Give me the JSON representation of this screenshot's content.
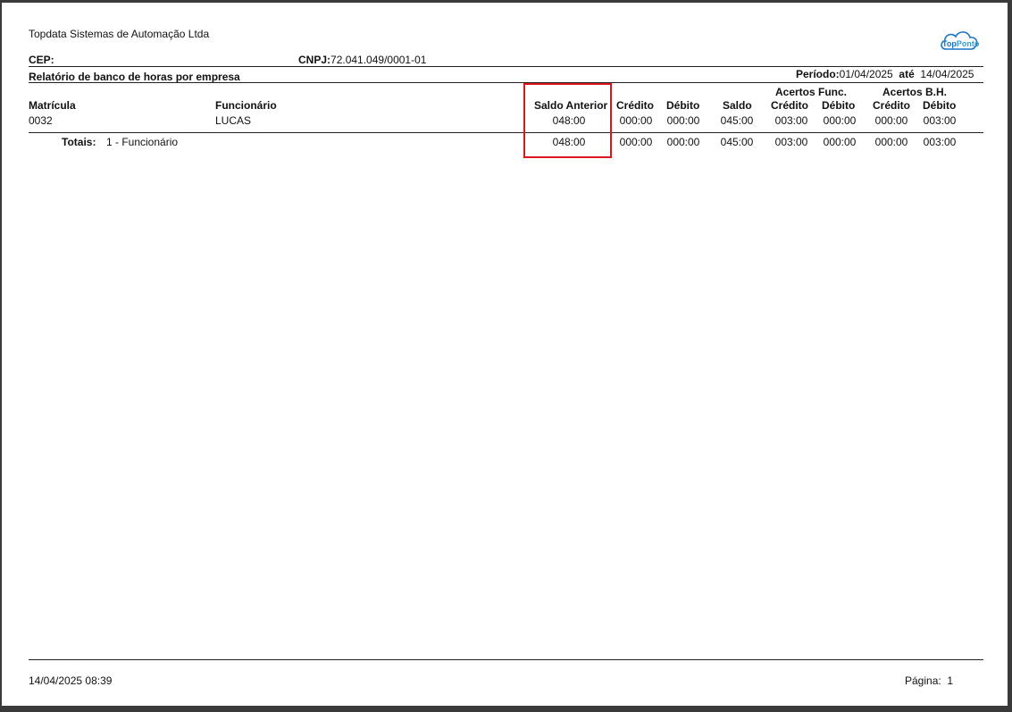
{
  "header": {
    "company": "Topdata Sistemas de Automação Ltda",
    "cep_label": "CEP:",
    "cnpj_label": "CNPJ:",
    "cnpj_value": "72.041.049/0001-01",
    "report_title": "Relatório de banco de horas por empresa",
    "period_label": "Período:",
    "period_start": "01/04/2025",
    "period_until": "até",
    "period_end": "14/04/2025",
    "logo_top": "Top",
    "logo_ponto": "Ponto"
  },
  "colors": {
    "highlight": "#d8161c",
    "logo_blue": "#1a74c4"
  },
  "columns": {
    "matricula": "Matrícula",
    "funcionario": "Funcionário",
    "saldo_anterior": "Saldo Anterior",
    "credito": "Crédito",
    "debito": "Débito",
    "saldo": "Saldo",
    "acertos_func": "Acertos Func.",
    "acertos_func_credito": "Crédito",
    "acertos_func_debito": "Débito",
    "acertos_bh": "Acertos B.H.",
    "acertos_bh_credito": "Crédito",
    "acertos_bh_debito": "Débito"
  },
  "rows": [
    {
      "matricula": "0032",
      "funcionario": "LUCAS",
      "saldo_anterior": "048:00",
      "credito": "000:00",
      "debito": "000:00",
      "saldo": "045:00",
      "af_credito": "003:00",
      "af_debito": "000:00",
      "bh_credito": "000:00",
      "bh_debito": "003:00"
    }
  ],
  "totals": {
    "label": "Totais:",
    "count": "1 - Funcionário",
    "saldo_anterior": "048:00",
    "credito": "000:00",
    "debito": "000:00",
    "saldo": "045:00",
    "af_credito": "003:00",
    "af_debito": "000:00",
    "bh_credito": "000:00",
    "bh_debito": "003:00"
  },
  "footer": {
    "datetime": "14/04/2025 08:39",
    "page_label": "Página:",
    "page_number": "1"
  }
}
